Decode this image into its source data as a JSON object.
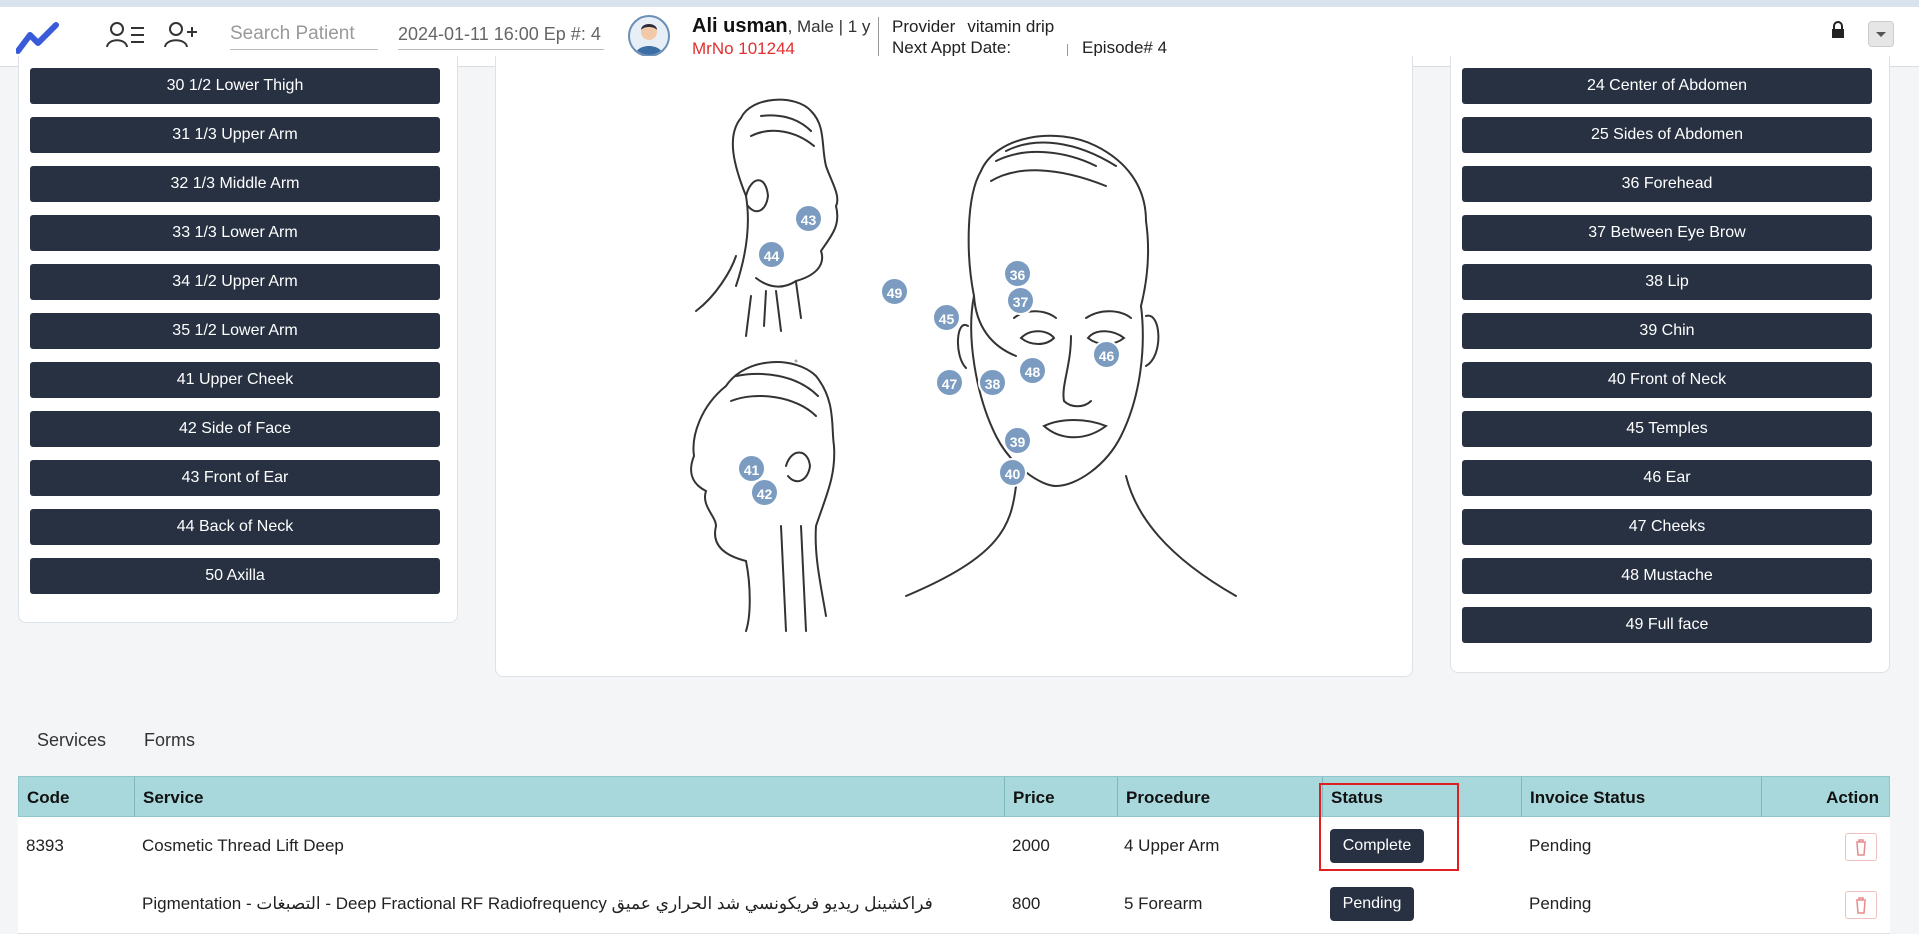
{
  "header": {
    "search_placeholder": "Search Patient",
    "date_episode": "2024-01-11 16:00 Ep #: 4",
    "patient_name": "Ali usman",
    "patient_meta": ", Male | 1 y",
    "mrno": "MrNo 101244",
    "provider_label": "Provider",
    "provider_value": "vitamin drip",
    "next_appt_label": "Next Appt Date:",
    "episode": "Episode# 4"
  },
  "left_buttons": [
    "30 1/2 Lower Thigh",
    "31 1/3 Upper Arm",
    "32 1/3 Middle Arm",
    "33 1/3 Lower Arm",
    "34 1/2 Upper Arm",
    "35 1/2 Lower Arm",
    "41 Upper Cheek",
    "42 Side of Face",
    "43 Front of Ear",
    "44 Back of Neck",
    "50 Axilla"
  ],
  "right_buttons": [
    "24 Center of Abdomen",
    "25 Sides of Abdomen",
    "36 Forehead",
    "37 Between Eye Brow",
    "38 Lip",
    "39 Chin",
    "40 Front of Neck",
    "45 Temples",
    "46 Ear",
    "47 Cheeks",
    "48 Mustache",
    "49 Full face"
  ],
  "markers": [
    "43",
    "44",
    "49",
    "36",
    "37",
    "45",
    "46",
    "48",
    "47",
    "38",
    "39",
    "40",
    "41",
    "42"
  ],
  "tabs": [
    "Services",
    "Forms"
  ],
  "table": {
    "columns": [
      "Code",
      "Service",
      "Price",
      "Procedure",
      "Status",
      "Invoice Status",
      "Action"
    ],
    "rows": [
      {
        "code": "8393",
        "service": "Cosmetic Thread Lift Deep",
        "price": "2000",
        "procedure": "4 Upper Arm",
        "status": "Complete",
        "invoice": "Pending"
      },
      {
        "code": "",
        "service": "Pigmentation - التصبغات - Deep Fractional RF Radiofrequency فراكشينل ريديو فريكونسي شد الحراري عميق",
        "price": "800",
        "procedure": "5 Forearm",
        "status": "Pending",
        "invoice": "Pending"
      }
    ]
  },
  "colors": {
    "button_dark": "#273142",
    "marker": "#7b9cc0",
    "table_header": "#a8d8dc",
    "highlight": "#e02020",
    "mrno": "#e03030"
  }
}
